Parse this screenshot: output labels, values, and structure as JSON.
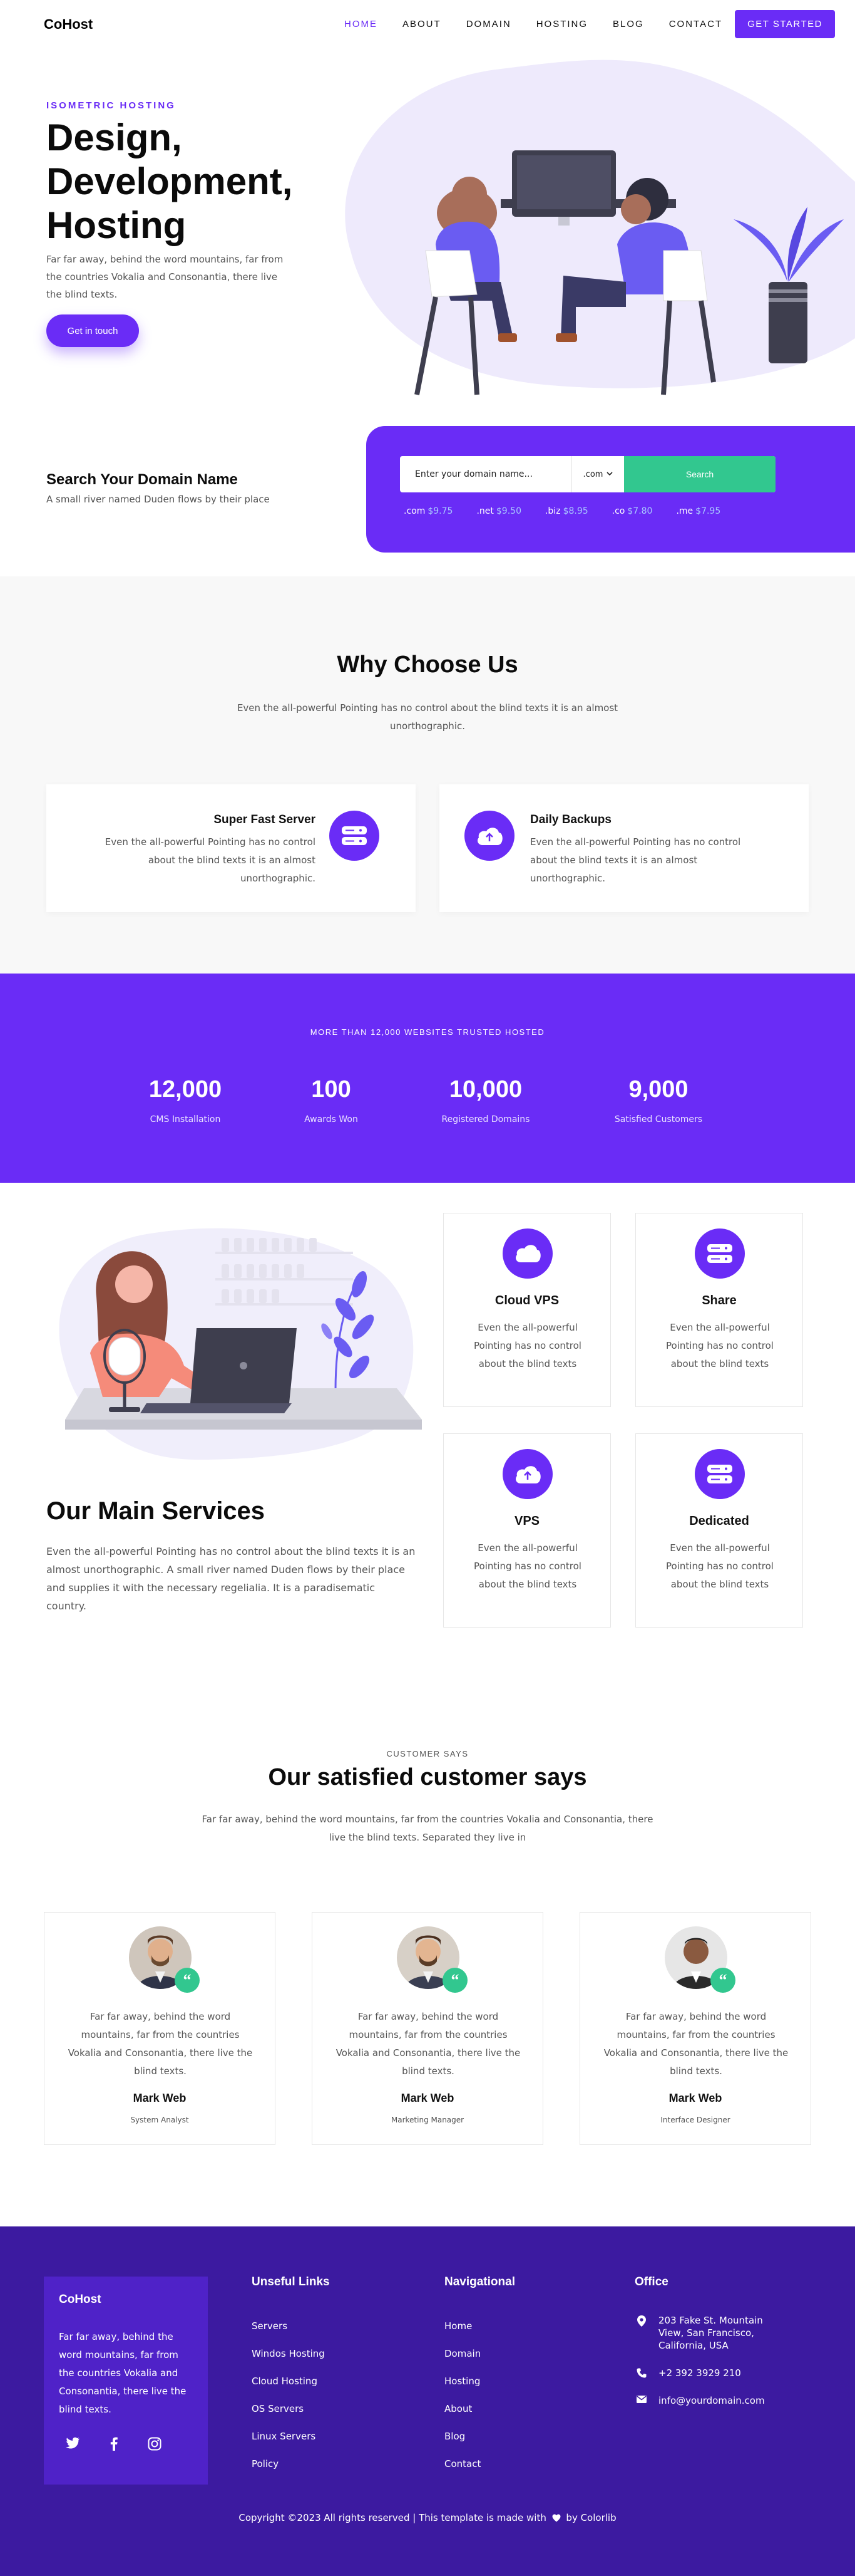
{
  "nav": {
    "brand": "CoHost",
    "items": [
      {
        "label": "Home",
        "active": true
      },
      {
        "label": "About"
      },
      {
        "label": "Domain"
      },
      {
        "label": "Hosting"
      },
      {
        "label": "Blog"
      },
      {
        "label": "Contact"
      }
    ],
    "cta": "Get Started"
  },
  "hero": {
    "kicker": "ISOMETRIC HOSTING",
    "title": "Design, Development, Hosting",
    "text": "Far far away, behind the word mountains, far from the countries Vokalia and Consonantia, there live the blind texts.",
    "button": "Get in touch"
  },
  "domain": {
    "title": "Search Your Domain Name",
    "subtitle": "A small river named Duden flows by their place",
    "placeholder": "Enter your domain name...",
    "selected_tld": ".com",
    "search_label": "Search",
    "prices": [
      {
        "tld": ".com",
        "price": "$9.75"
      },
      {
        "tld": ".net",
        "price": "$9.50"
      },
      {
        "tld": ".biz",
        "price": "$8.95"
      },
      {
        "tld": ".co",
        "price": "$7.80"
      },
      {
        "tld": ".me",
        "price": "$7.95"
      }
    ]
  },
  "why": {
    "title": "Why Choose Us",
    "subtitle": "Even the all-powerful Pointing has no control about the blind texts it is an almost unorthographic.",
    "features": [
      {
        "title": "Super Fast Server",
        "text": "Even the all-powerful Pointing has no control about the blind texts it is an almost unorthographic.",
        "icon": "server-icon"
      },
      {
        "title": "Daily Backups",
        "text": "Even the all-powerful Pointing has no control about the blind texts it is an almost unorthographic.",
        "icon": "cloud-upload-icon"
      }
    ]
  },
  "stats": {
    "kicker": "MORE THAN 12,000 WEBSITES TRUSTED HOSTED",
    "items": [
      {
        "number": "12,000",
        "label": "CMS Installation"
      },
      {
        "number": "100",
        "label": "Awards Won"
      },
      {
        "number": "10,000",
        "label": "Registered Domains"
      },
      {
        "number": "9,000",
        "label": "Satisfied Customers"
      }
    ]
  },
  "services": {
    "title": "Our Main Services",
    "text": "Even the all-powerful Pointing has no control about the blind texts it is an almost unorthographic. A small river named Duden flows by their place and supplies it with the necessary regelialia. It is a paradisematic country.",
    "cards": [
      {
        "name": "Cloud VPS",
        "text": "Even the all-powerful Pointing has no control about the blind texts",
        "icon": "cloud-icon"
      },
      {
        "name": "Share",
        "text": "Even the all-powerful Pointing has no control about the blind texts",
        "icon": "server-icon"
      },
      {
        "name": "VPS",
        "text": "Even the all-powerful Pointing has no control about the blind texts",
        "icon": "cloud-upload-icon"
      },
      {
        "name": "Dedicated",
        "text": "Even the all-powerful Pointing has no control about the blind texts",
        "icon": "server-icon"
      }
    ]
  },
  "testimonials": {
    "kicker": "CUSTOMER SAYS",
    "title": "Our satisfied customer says",
    "subtitle": "Far far away, behind the word mountains, far from the countries Vokalia and Consonantia, there live the blind texts. Separated they live in",
    "items": [
      {
        "text": "Far far away, behind the word mountains, far from the countries Vokalia and Consonantia, there live the blind texts.",
        "name": "Mark Web",
        "role": "System Analyst"
      },
      {
        "text": "Far far away, behind the word mountains, far from the countries Vokalia and Consonantia, there live the blind texts.",
        "name": "Mark Web",
        "role": "Marketing Manager"
      },
      {
        "text": "Far far away, behind the word mountains, far from the countries Vokalia and Consonantia, there live the blind texts.",
        "name": "Mark Web",
        "role": "Interface Designer"
      }
    ]
  },
  "footer": {
    "brand": "CoHost",
    "about": "Far far away, behind the word mountains, far from the countries Vokalia and Consonantia, there live the blind texts.",
    "useful_title": "Unseful Links",
    "useful_links": [
      "Servers",
      "Windos Hosting",
      "Cloud Hosting",
      "OS Servers",
      "Linux Servers",
      "Policy"
    ],
    "nav_title": "Navigational",
    "nav_links": [
      "Home",
      "Domain",
      "Hosting",
      "About",
      "Blog",
      "Contact"
    ],
    "office_title": "Office",
    "address": "203 Fake St. Mountain View, San Francisco, California, USA",
    "phone": "+2 392 3929 210",
    "email": "info@yourdomain.com",
    "copyright_prefix": "Copyright ©2023 All rights reserved | This template is made with",
    "copyright_suffix": "by Colorlib"
  },
  "colors": {
    "accent": "#6a2cf6",
    "green": "#32c78f",
    "footer": "#3c1aa0",
    "footer_box": "#4f22c8"
  }
}
